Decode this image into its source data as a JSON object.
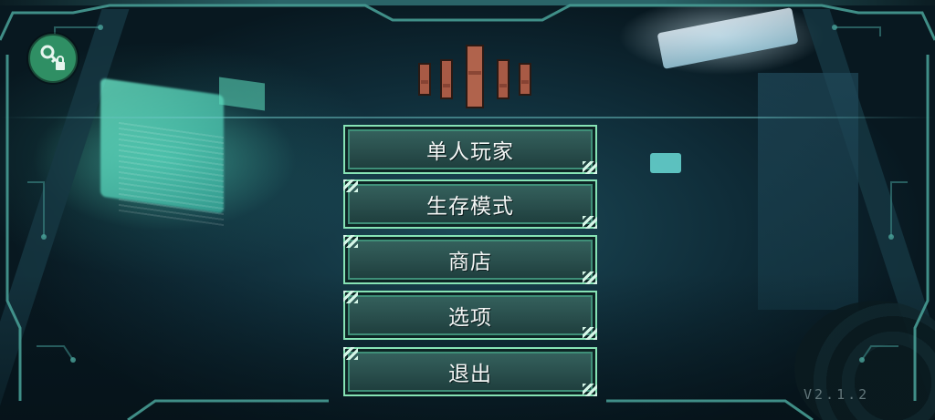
{
  "menu": {
    "items": [
      {
        "label": "单人玩家"
      },
      {
        "label": "生存模式"
      },
      {
        "label": "商店"
      },
      {
        "label": "选项"
      },
      {
        "label": "退出"
      }
    ]
  },
  "version": "V2.1.2",
  "icons": {
    "top_left": "key-lock-icon",
    "logo": "game-logo"
  },
  "colors": {
    "button_border": "#86e3b5",
    "key_button": "#2f8f64",
    "logo": "#a85a45",
    "text": "#f3f6f5"
  }
}
